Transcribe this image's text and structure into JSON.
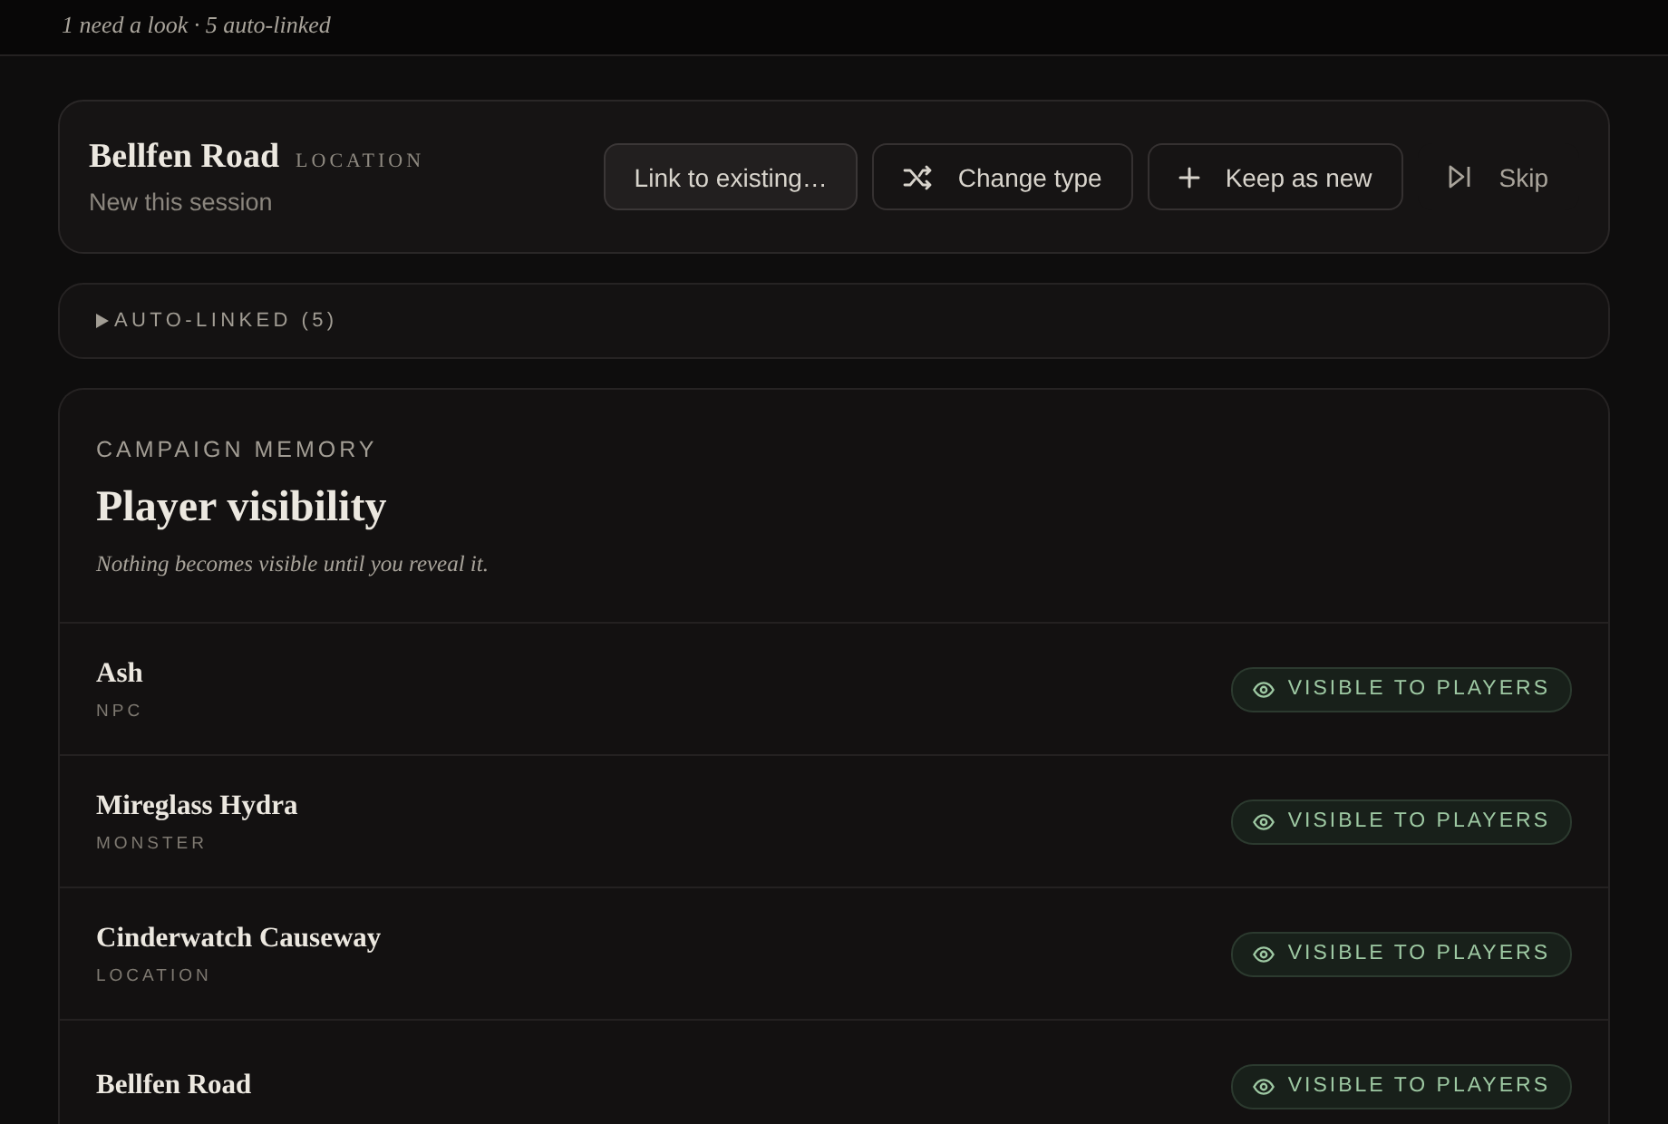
{
  "header": {
    "summary": "1 need a look · 5 auto-linked"
  },
  "review": {
    "name": "Bellfen Road",
    "type": "LOCATION",
    "note": "New this session",
    "actions": [
      {
        "kind": "link",
        "label": "Link to existing…"
      },
      {
        "kind": "change",
        "label": "Change type"
      },
      {
        "kind": "keep",
        "label": "Keep as new"
      },
      {
        "kind": "skip",
        "label": "Skip"
      }
    ]
  },
  "auto_linked": {
    "label": "AUTO-LINKED (5)",
    "expanded": false
  },
  "memory": {
    "eyebrow": "CAMPAIGN MEMORY",
    "title": "Player visibility",
    "subtitle": "Nothing becomes visible until you reveal it.",
    "entries": [
      {
        "name": "Ash",
        "type": "NPC",
        "visible": true,
        "badge": "VISIBLE TO PLAYERS"
      },
      {
        "name": "Mireglass Hydra",
        "type": "MONSTER",
        "visible": true,
        "badge": "VISIBLE TO PLAYERS"
      },
      {
        "name": "Cinderwatch Causeway",
        "type": "LOCATION",
        "visible": true,
        "badge": "VISIBLE TO PLAYERS"
      },
      {
        "name": "Bellfen Road",
        "visible": true,
        "badge": "VISIBLE TO PLAYERS"
      }
    ]
  }
}
